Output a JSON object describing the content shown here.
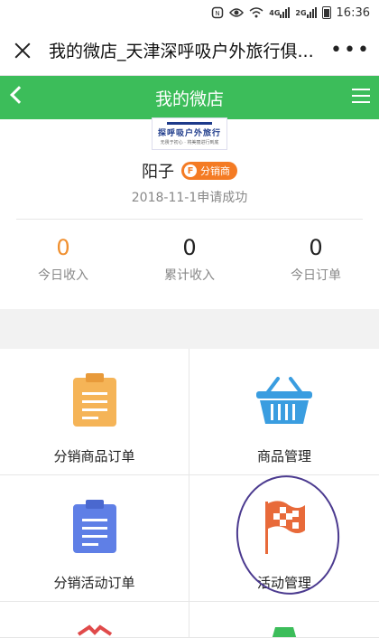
{
  "status_bar": {
    "icons": [
      "nfc-icon",
      "eye-icon",
      "wifi-icon",
      "signal-4g-icon",
      "signal-2g-icon",
      "battery-icon"
    ],
    "net_4g": "4G",
    "net_2g": "2G",
    "time": "16:36"
  },
  "wechat_bar": {
    "title": "我的微店_天津深呼吸户外旅行俱...",
    "more": "•••"
  },
  "header": {
    "title": "我的微店",
    "accent_color": "#3cbd5a"
  },
  "profile": {
    "logo_text": "探呼吸户外旅行",
    "logo_slogan": "无畏于初心 · 将美丽进行到底",
    "name": "阳子",
    "badge_letter": "F",
    "badge_label": "分销商",
    "apply_status": "2018-11-1申请成功"
  },
  "stats": [
    {
      "value": "0",
      "label": "今日收入"
    },
    {
      "value": "0",
      "label": "累计收入"
    },
    {
      "value": "0",
      "label": "今日订单"
    }
  ],
  "menu": [
    {
      "label": "分销商品订单",
      "icon": "clipboard-orange-icon"
    },
    {
      "label": "商品管理",
      "icon": "basket-icon"
    },
    {
      "label": "分销活动订单",
      "icon": "clipboard-blue-icon"
    },
    {
      "label": "活动管理",
      "icon": "checkered-flag-icon"
    }
  ]
}
